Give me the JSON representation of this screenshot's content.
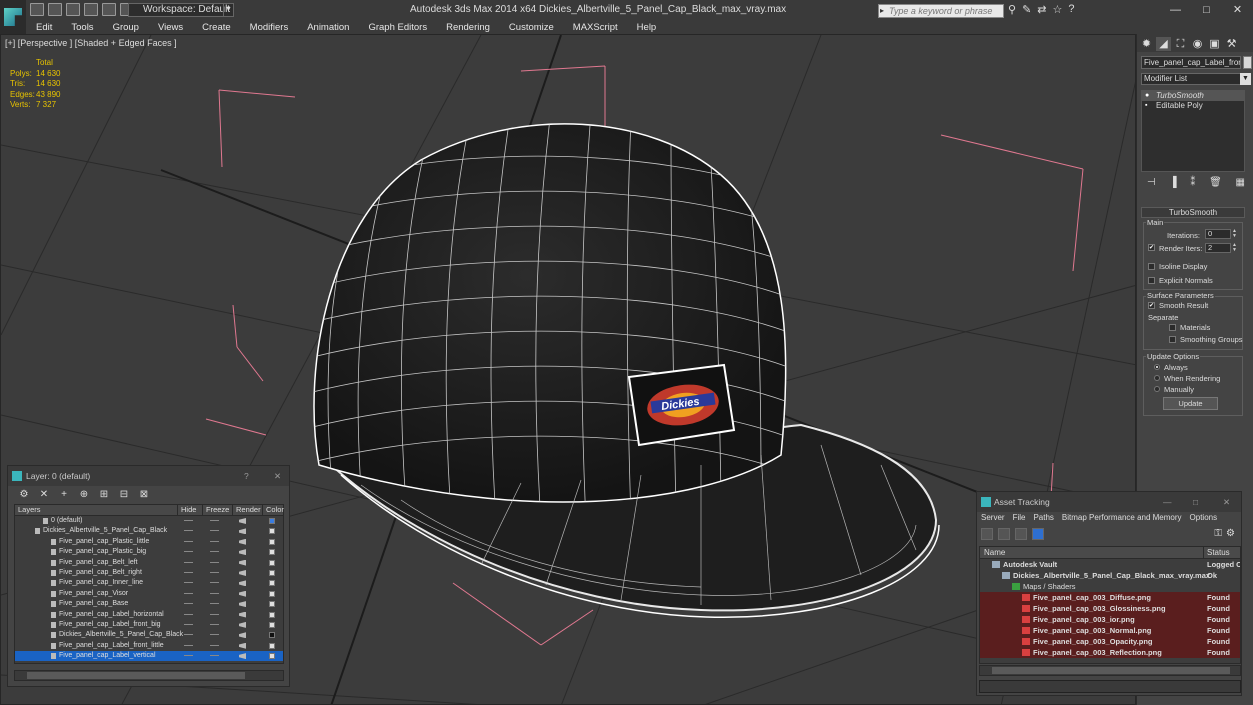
{
  "titlebar": {
    "title": "Autodesk 3ds Max  2014 x64     Dickies_Albertville_5_Panel_Cap_Black_max_vray.max",
    "workspace": "Workspace: Default",
    "search_placeholder": "Type a keyword or phrase",
    "window_buttons": [
      "—",
      "□",
      "✕"
    ]
  },
  "menu": [
    "Edit",
    "Tools",
    "Group",
    "Views",
    "Create",
    "Modifiers",
    "Animation",
    "Graph Editors",
    "Rendering",
    "Customize",
    "MAXScript",
    "Help"
  ],
  "viewport": {
    "label": "[+] [Perspective ] [Shaded + Edged Faces ]",
    "stats": {
      "total_label": "Total",
      "rows": [
        {
          "k": "Polys:",
          "v": "14 630"
        },
        {
          "k": "Tris:",
          "v": "14 630"
        },
        {
          "k": "Edges:",
          "v": "43 890"
        },
        {
          "k": "Verts:",
          "v": "7 327"
        }
      ]
    },
    "logo_text": "Dickies"
  },
  "command_panel": {
    "object_name": "Five_panel_cap_Label_front_",
    "modifier_list": "Modifier List",
    "stack": [
      "TurboSmooth",
      "Editable Poly"
    ],
    "rollout_title": "TurboSmooth",
    "main_group": "Main",
    "iterations_label": "Iterations:",
    "iterations_value": "0",
    "render_iters_label": "Render Iters:",
    "render_iters_value": "2",
    "isoline_label": "Isoline Display",
    "explicit_normals_label": "Explicit Normals",
    "surface_group": "Surface Parameters",
    "smooth_result_label": "Smooth Result",
    "separate_label": "Separate",
    "materials_label": "Materials",
    "smoothing_groups_label": "Smoothing Groups",
    "update_group": "Update Options",
    "always_label": "Always",
    "when_rendering_label": "When Rendering",
    "manually_label": "Manually",
    "update_button": "Update"
  },
  "layer_window": {
    "title": "Layer: 0 (default)",
    "help": "?",
    "close": "✕",
    "columns": [
      "Layers",
      "Hide",
      "Freeze",
      "Render",
      "Color"
    ],
    "rows": [
      {
        "name": "0 (default)",
        "indent": 1,
        "selected": false,
        "color": "#3b7de0"
      },
      {
        "name": "Dickies_Albertville_5_Panel_Cap_Black",
        "indent": 0,
        "selected": false,
        "color": "#e0e0e0"
      },
      {
        "name": "Five_panel_cap_Plastic_little",
        "indent": 2,
        "selected": false,
        "color": "#e0e0e0"
      },
      {
        "name": "Five_panel_cap_Plastic_big",
        "indent": 2,
        "selected": false,
        "color": "#e0e0e0"
      },
      {
        "name": "Five_panel_cap_Belt_left",
        "indent": 2,
        "selected": false,
        "color": "#e0e0e0"
      },
      {
        "name": "Five_panel_cap_Belt_right",
        "indent": 2,
        "selected": false,
        "color": "#e0e0e0"
      },
      {
        "name": "Five_panel_cap_Inner_line",
        "indent": 2,
        "selected": false,
        "color": "#e0e0e0"
      },
      {
        "name": "Five_panel_cap_Visor",
        "indent": 2,
        "selected": false,
        "color": "#e0e0e0"
      },
      {
        "name": "Five_panel_cap_Base",
        "indent": 2,
        "selected": false,
        "color": "#e0e0e0"
      },
      {
        "name": "Five_panel_cap_Label_horizontal",
        "indent": 2,
        "selected": false,
        "color": "#e0e0e0"
      },
      {
        "name": "Five_panel_cap_Label_front_big",
        "indent": 2,
        "selected": false,
        "color": "#e0e0e0"
      },
      {
        "name": "Dickies_Albertville_5_Panel_Cap_Black",
        "indent": 2,
        "selected": false,
        "color": "#111111"
      },
      {
        "name": "Five_panel_cap_Label_front_little",
        "indent": 2,
        "selected": false,
        "color": "#e0e0e0"
      },
      {
        "name": "Five_panel_cap_Label_vertical",
        "indent": 2,
        "selected": true,
        "color": "#e0e0e0"
      }
    ]
  },
  "asset_window": {
    "title": "Asset Tracking",
    "menu": [
      "Server",
      "File",
      "Paths",
      "Bitmap Performance and Memory",
      "Options"
    ],
    "columns": [
      "Name",
      "Status"
    ],
    "rows": [
      {
        "name": "Autodesk Vault",
        "status": "Logged C",
        "indent": 0,
        "bold": true
      },
      {
        "name": "Dickies_Albertville_5_Panel_Cap_Black_max_vray.max",
        "status": "Ok",
        "indent": 1,
        "bold": true
      },
      {
        "name": "Maps / Shaders",
        "status": "",
        "indent": 2,
        "bold": false
      },
      {
        "name": "Five_panel_cap_003_Diffuse.png",
        "status": "Found",
        "indent": 3,
        "bold": true
      },
      {
        "name": "Five_panel_cap_003_Glossiness.png",
        "status": "Found",
        "indent": 3,
        "bold": true
      },
      {
        "name": "Five_panel_cap_003_ior.png",
        "status": "Found",
        "indent": 3,
        "bold": true
      },
      {
        "name": "Five_panel_cap_003_Normal.png",
        "status": "Found",
        "indent": 3,
        "bold": true
      },
      {
        "name": "Five_panel_cap_003_Opacity.png",
        "status": "Found",
        "indent": 3,
        "bold": true
      },
      {
        "name": "Five_panel_cap_003_Reflection.png",
        "status": "Found",
        "indent": 3,
        "bold": true
      }
    ]
  }
}
